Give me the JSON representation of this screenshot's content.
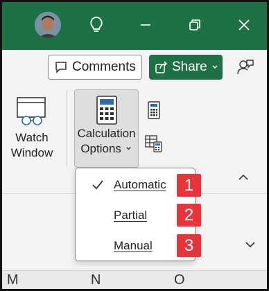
{
  "titlebar": {
    "icons": [
      "avatar",
      "lightbulb-icon",
      "minimize-icon",
      "restore-icon",
      "close-icon"
    ]
  },
  "sharebar": {
    "comments_label": "Comments",
    "share_label": "Share",
    "icons": [
      "comment-icon",
      "share-icon",
      "chevron-down-icon",
      "coauthoring-icon"
    ]
  },
  "ribbon": {
    "watch_line1": "Watch",
    "watch_line2": "Window",
    "calc_line1": "Calculation",
    "calc_line2": "Options",
    "icons": [
      "watch-window-icon",
      "calculator-icon",
      "calculate-now-icon",
      "calculate-sheet-icon",
      "collapse-ribbon-icon"
    ]
  },
  "calc_menu": {
    "items": [
      {
        "label": "Automatic",
        "checked": true,
        "badge": "1"
      },
      {
        "label": "Partial",
        "checked": false,
        "badge": "2"
      },
      {
        "label": "Manual",
        "checked": false,
        "badge": "3"
      }
    ]
  },
  "columns": [
    "M",
    "N",
    "O"
  ],
  "colors": {
    "title_bg": "#1e7145",
    "share_bg": "#1e7145",
    "badge_bg": "#e8353c",
    "ribbon_bg": "#f3f3f3"
  }
}
